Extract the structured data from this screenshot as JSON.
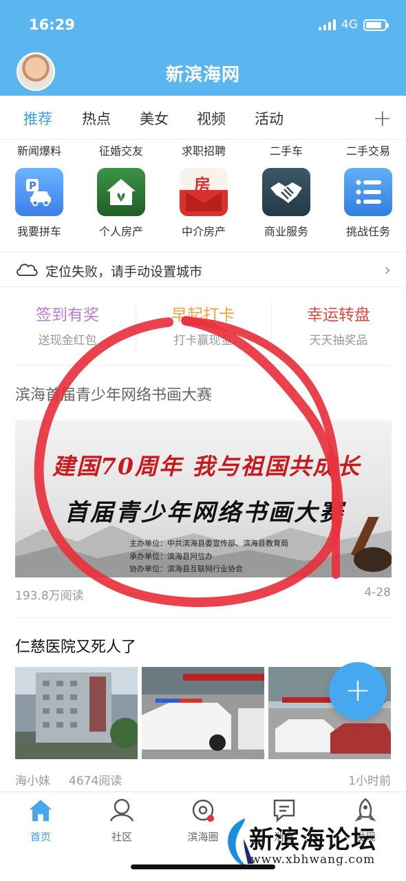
{
  "status": {
    "time": "16:29",
    "network": "4G"
  },
  "header": {
    "title": "新滨海网",
    "avatar": "avatar"
  },
  "tabs": {
    "items": [
      {
        "label": "推荐",
        "active": true
      },
      {
        "label": "热点",
        "active": false
      },
      {
        "label": "美女",
        "active": false
      },
      {
        "label": "视频",
        "active": false
      },
      {
        "label": "活动",
        "active": false
      }
    ],
    "add_icon": "plus-icon",
    "accent": "#3a9ee6"
  },
  "shortcuts_top": [
    "新闻爆料",
    "征婚交友",
    "求职招聘",
    "二手车",
    "二手交易"
  ],
  "shortcuts": [
    {
      "label": "我要拼车",
      "icon": "carpool-icon",
      "color": "#4f8ef0"
    },
    {
      "label": "个人房产",
      "icon": "house-icon",
      "color": "#2f7d38"
    },
    {
      "label": "中介房产",
      "icon": "agency-house-icon",
      "color": "#d8322e"
    },
    {
      "label": "商业服务",
      "icon": "handshake-icon",
      "color": "#2f4a58"
    },
    {
      "label": "挑战任务",
      "icon": "task-list-icon",
      "color": "#3b8fe8"
    }
  ],
  "location": {
    "text": "定位失败，请手动设置城市",
    "icon": "cloud-icon"
  },
  "promos": [
    {
      "title": "签到有奖",
      "subtitle": "送现金红包",
      "color": "#c07ad8"
    },
    {
      "title": "早起打卡",
      "subtitle": "打卡赢现金",
      "color": "#f2a233"
    },
    {
      "title": "幸运转盘",
      "subtitle": "天天抽奖品",
      "color": "#e0463c"
    }
  ],
  "article1": {
    "title": "滨海首届青少年网络书画大赛",
    "banner_line1": "建国70周年 我与祖国共成长",
    "banner_line2": "首届青少年网络书画大赛",
    "banner_orgs": [
      "主办单位：中共滨海县委宣传部、滨海县教育局",
      "承办单位：滨海县网信办",
      "协办单位：滨海县互联网行业协会"
    ],
    "reads": "193.8万阅读",
    "date": "4-28"
  },
  "article2": {
    "title": "仁慈医院又死人了",
    "author": "海小妹",
    "reads": "4674阅读",
    "time": "1小时前"
  },
  "fab": {
    "icon": "plus-icon"
  },
  "bottom_nav": [
    {
      "label": "首页",
      "icon": "home-icon",
      "active": true
    },
    {
      "label": "社区",
      "icon": "community-icon",
      "active": false
    },
    {
      "label": "滨海圈",
      "icon": "circle-icon",
      "active": false
    },
    {
      "label": "消息",
      "icon": "message-icon",
      "active": false
    },
    {
      "label": "发现",
      "icon": "rocket-icon",
      "active": false
    }
  ],
  "watermark": {
    "name": "新滨海论坛",
    "url": "www.xbhwang.com"
  }
}
